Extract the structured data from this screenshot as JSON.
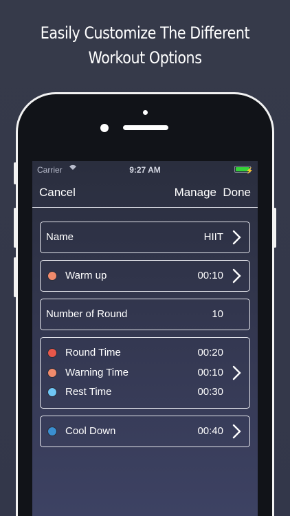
{
  "promo": {
    "line1": "Easily Customize The Different",
    "line2": "Workout Options"
  },
  "statusbar": {
    "carrier": "Carrier",
    "time": "9:27 AM"
  },
  "navbar": {
    "cancel": "Cancel",
    "manage": "Manage",
    "done": "Done"
  },
  "name_row": {
    "label": "Name",
    "value": "HIIT"
  },
  "warmup_row": {
    "label": "Warm up",
    "value": "00:10",
    "color": "#f08a6c"
  },
  "rounds_row": {
    "label": "Number of Round",
    "value": "10"
  },
  "times": [
    {
      "label": "Round Time",
      "value": "00:20",
      "color": "#e8574a"
    },
    {
      "label": "Warning Time",
      "value": "00:10",
      "color": "#f08a6c"
    },
    {
      "label": "Rest Time",
      "value": "00:30",
      "color": "#6fc6f5"
    }
  ],
  "cooldown_row": {
    "label": "Cool Down",
    "value": "00:40",
    "color": "#3a8fd0"
  }
}
